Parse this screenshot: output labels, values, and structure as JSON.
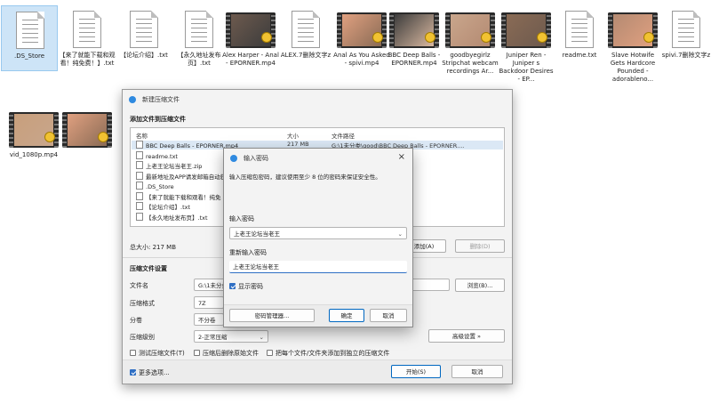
{
  "files": [
    {
      "name": ".DS_Store",
      "kind": "doc",
      "selected": true
    },
    {
      "name": "【来了就能下载和观看！纯免费！】.txt",
      "kind": "doc"
    },
    {
      "name": "【论坛介绍】.txt",
      "kind": "doc"
    },
    {
      "name": "【永久地址发布页】.txt",
      "kind": "doc"
    },
    {
      "name": "Alex Harper - Anal - EPORNER.mp4",
      "kind": "video"
    },
    {
      "name": "ALEX.7删除文字z",
      "kind": "doc"
    },
    {
      "name": "Anal As You Asked - spivi.mp4",
      "kind": "video"
    },
    {
      "name": "BBC Deep Balls - EPORNER.mp4",
      "kind": "video"
    },
    {
      "name": "goodbyegirlz Stripchat webcam recordings Ar...",
      "kind": "video"
    },
    {
      "name": "Juniper Ren - Juniper s Backdoor Desires - EP...",
      "kind": "video"
    },
    {
      "name": "readme.txt",
      "kind": "doc"
    },
    {
      "name": "Slave Hotwife Gets Hardcore Pounded - adorableno...",
      "kind": "video"
    },
    {
      "name": "spivi.7删除文字z",
      "kind": "doc"
    },
    {
      "name": "vid_1080p.mp4",
      "kind": "video"
    },
    {
      "name": "",
      "kind": "video"
    }
  ],
  "main_dialog": {
    "title": "新建压缩文件",
    "add_section": "添加文件到压缩文件",
    "col_name": "名称",
    "col_size": "大小",
    "col_path": "文件路径",
    "rows": [
      {
        "name": "BBC Deep Balls - EPORNER.mp4",
        "size": "217 MB",
        "path": "G:\\1未分类\\good\\BBC Deep Balls - EPORNER...."
      },
      {
        "name": "readme.txt",
        "size": "",
        "path": ""
      },
      {
        "name": "上老王论坛当老王.zip",
        "size": "",
        "path": ""
      },
      {
        "name": "最新地址及APP请发邮箱自动获",
        "size": "",
        "path": "邮箱自动获"
      },
      {
        "name": ".DS_Store",
        "size": "",
        "path": ""
      },
      {
        "name": "【来了就能下载和观看！纯免",
        "size": "",
        "path": "下载和观看！纯免..."
      },
      {
        "name": "【论坛介绍】.txt",
        "size": "",
        "path": "txt"
      },
      {
        "name": "【永久地址发布页】.txt",
        "size": "",
        "path": "发布页】.txt"
      }
    ],
    "total": "总大小: 217 MB",
    "add_btn": "添加(A)",
    "delete_btn": "删除(D)",
    "settings_section": "压缩文件设置",
    "filename_label": "文件名",
    "filename_value": "G:\\1未分类",
    "browse_btn": "浏览(B)...",
    "format_label": "压缩格式",
    "format_value": "7Z",
    "split_label": "分卷",
    "split_value": "不分卷",
    "level_label": "压缩级别",
    "level_value": "2-正常压缩",
    "advanced_btn": "高级设置 »",
    "opt_test": "测试压缩文件(T)",
    "opt_delete": "压缩后删除原始文件",
    "opt_separate": "把每个文件/文件夹添加到独立的压缩文件",
    "more_options": "更多选项...",
    "start_btn": "开始(S)",
    "cancel_btn": "取消"
  },
  "password_dialog": {
    "title": "输入密码",
    "close": "×",
    "description": "输入压缩包密码，建议使用至少 8 位的密码来保证安全性。",
    "pw_label": "输入密码",
    "pw_value": "上老王论坛当老王",
    "repeat_label": "重新输入密码",
    "repeat_value": "上老王论坛当老王",
    "show_password": "显示密码",
    "manager_btn": "密码管理器...",
    "ok_btn": "确定",
    "cancel_btn": "取消"
  },
  "colors": {
    "accent": "#2f6fc4",
    "selection": "#cde4f7",
    "dialog_bg": "#f3f3f3"
  }
}
